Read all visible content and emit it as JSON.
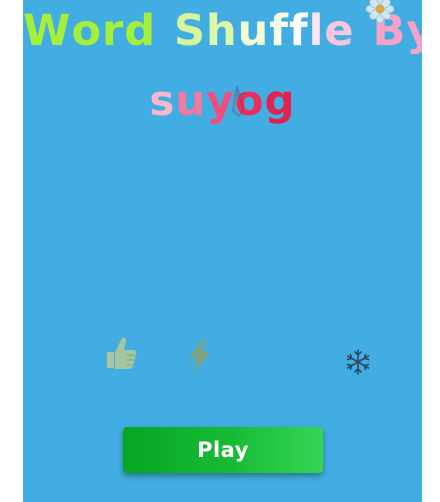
{
  "title": {
    "line1": {
      "word1": [
        "W",
        "o",
        "r",
        "d"
      ],
      "word2": [
        "S",
        "h",
        "u",
        "f",
        "f",
        "l",
        "e"
      ],
      "word3": [
        "B",
        "y"
      ]
    },
    "line2": [
      "s",
      "u",
      "y",
      "o",
      "g"
    ]
  },
  "title_colors": {
    "word1": "#a6ee3c",
    "word2": [
      "#d7f59a",
      "#e0f7a8",
      "#f2fbd2",
      "#fbfde9",
      "#ffffff",
      "#fde6ee",
      "#f8c6d8"
    ],
    "word3": "#f4a3c7",
    "line2": [
      "#f8b7cd",
      "#f27aa0",
      "#ee4f7c",
      "#e8305e",
      "#e0234f"
    ]
  },
  "icons": {
    "flower": "flower-icon",
    "pencil": "pencil-icon",
    "like": "thumbs-up-icon",
    "bolt": "lightning-bolt-icon",
    "freeze": "snowflake-icon"
  },
  "colors": {
    "background": "#42ade3",
    "play_button": "#16b535",
    "thumbs_up": "#9ec3a0",
    "bolt": "#7fa37e",
    "snowflake": "#2c4a5e"
  },
  "play_button": {
    "label": "Play"
  }
}
